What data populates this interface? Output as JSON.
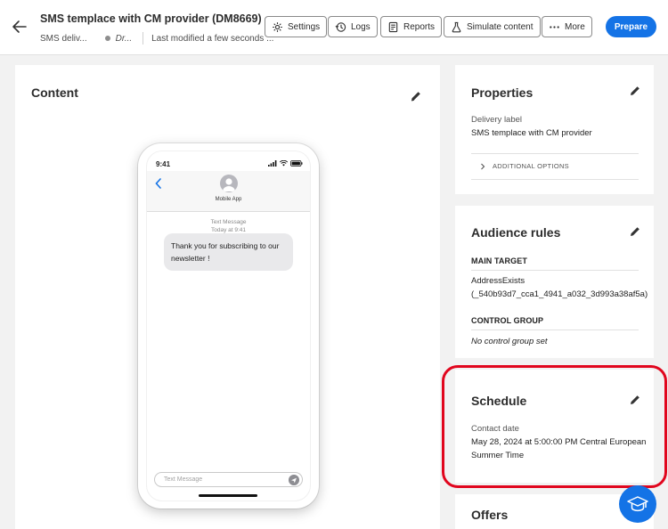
{
  "header": {
    "title": "SMS templace with CM provider (DM8669)",
    "channel": "SMS deliv...",
    "status": "Dr...",
    "modified": "Last modified a few seconds ...",
    "buttons": {
      "settings": "Settings",
      "logs": "Logs",
      "reports": "Reports",
      "simulate": "Simulate content",
      "more": "More",
      "prepare": "Prepare"
    }
  },
  "content": {
    "title": "Content",
    "phone": {
      "time": "9:41",
      "contact": "Mobile App",
      "meta_type": "Text Message",
      "meta_time": "Today at 9:41",
      "message": "Thank you for subscribing to our newsletter !",
      "compose_placeholder": "Text Message"
    }
  },
  "properties": {
    "title": "Properties",
    "delivery_label_label": "Delivery label",
    "delivery_label_value": "SMS templace with CM provider",
    "additional_options": "ADDITIONAL OPTIONS"
  },
  "audience": {
    "title": "Audience rules",
    "main_target_heading": "MAIN TARGET",
    "main_target_line1": "AddressExists",
    "main_target_line2": "(_540b93d7_cca1_4941_a032_3d993a38af5a)",
    "control_group_heading": "CONTROL GROUP",
    "control_group_value": "No control group set"
  },
  "schedule": {
    "title": "Schedule",
    "contact_date_label": "Contact date",
    "contact_date_line1": "May 28, 2024 at 5:00:00 PM Central European",
    "contact_date_line2": "Summer Time"
  },
  "offers": {
    "title": "Offers"
  },
  "colors": {
    "accent": "#1473e6",
    "highlight": "#e1061e"
  }
}
